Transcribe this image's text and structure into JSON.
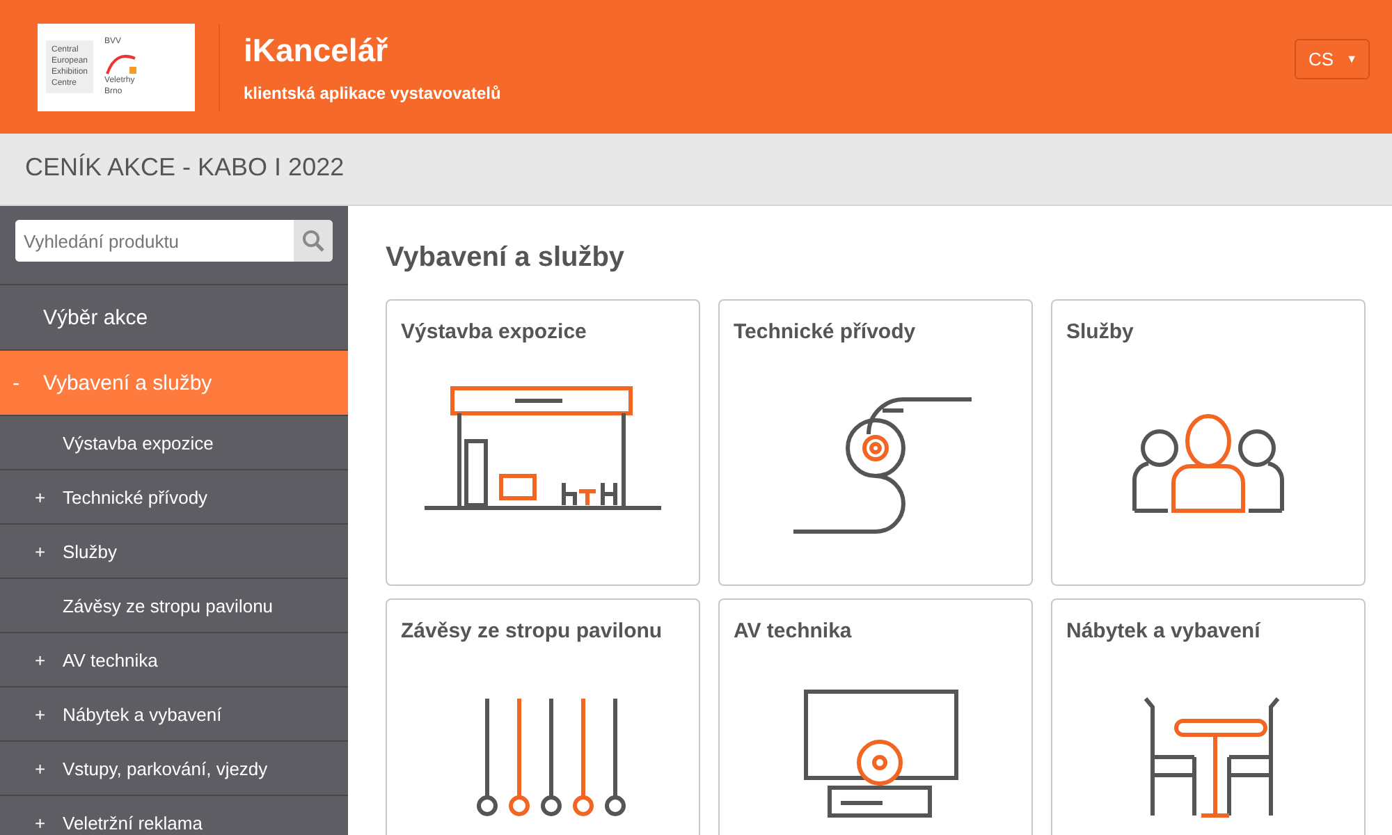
{
  "header": {
    "logo": {
      "lines": [
        "Central",
        "European",
        "Exhibition",
        "Centre"
      ],
      "brand": "BVV",
      "sub": [
        "Veletrhy",
        "Brno"
      ]
    },
    "title": "iKancelář",
    "subtitle": "klientská aplikace vystavovatelů",
    "language": {
      "value": "CS",
      "caret": "▼"
    }
  },
  "page_title": "CENÍK AKCE - KABO I 2022",
  "sidebar": {
    "search": {
      "placeholder": "Vyhledání produktu"
    },
    "items": [
      {
        "label": "Výběr akce",
        "selected": false
      },
      {
        "label": "Vybavení a služby",
        "marker": "-",
        "selected": true,
        "children": [
          {
            "label": "Výstavba expozice"
          },
          {
            "label": "Technické přívody",
            "marker": "+"
          },
          {
            "label": "Služby",
            "marker": "+"
          },
          {
            "label": "Závěsy ze stropu pavilonu"
          },
          {
            "label": "AV technika",
            "marker": "+"
          },
          {
            "label": "Nábytek a vybavení",
            "marker": "+"
          },
          {
            "label": "Vstupy, parkování, vjezdy",
            "marker": "+"
          },
          {
            "label": "Veletržní reklama",
            "marker": "+"
          }
        ]
      }
    ]
  },
  "content": {
    "heading": "Vybavení a služby",
    "cards": [
      {
        "title": "Výstavba expozice",
        "kind": "booth"
      },
      {
        "title": "Technické přívody",
        "kind": "cables"
      },
      {
        "title": "Služby",
        "kind": "people"
      },
      {
        "title": "Závěsy ze stropu pavilonu",
        "kind": "hangings"
      },
      {
        "title": "AV technika",
        "kind": "tv"
      },
      {
        "title": "Nábytek a vybavení",
        "kind": "furniture"
      }
    ]
  }
}
